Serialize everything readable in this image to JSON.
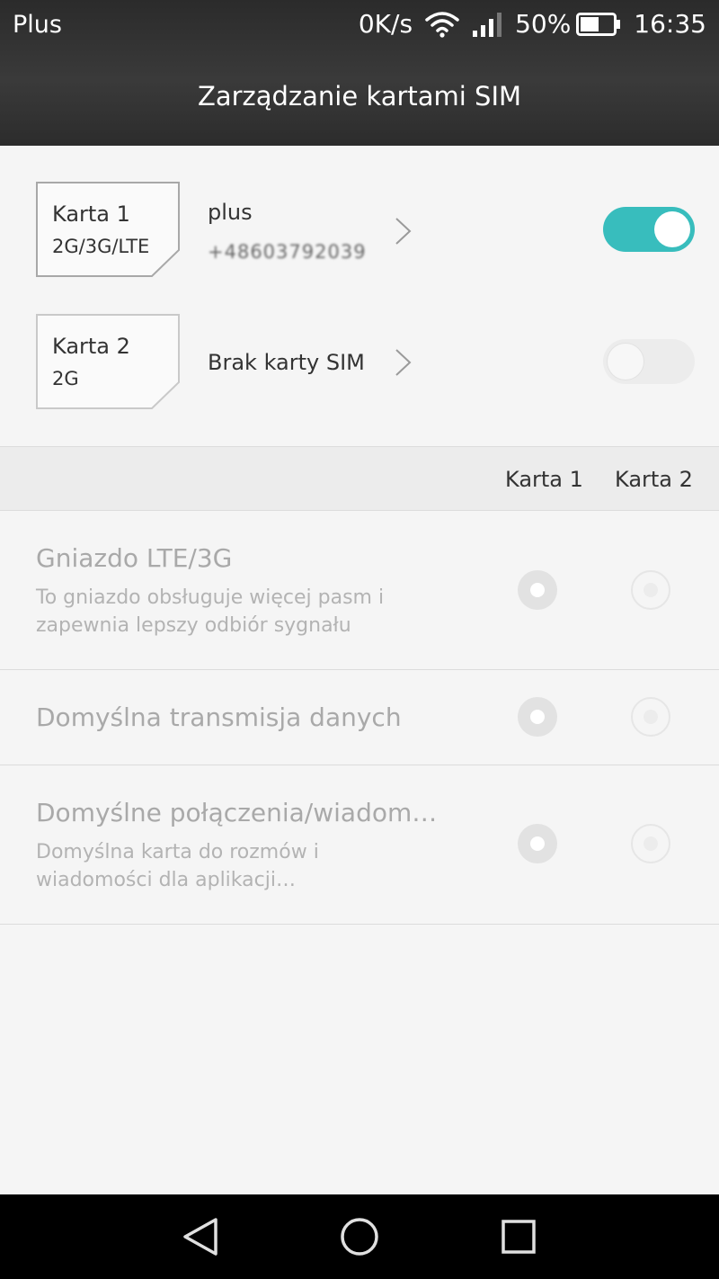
{
  "status_bar": {
    "carrier": "Plus",
    "speed": "0K/s",
    "battery": "50%",
    "time": "16:35",
    "icons": [
      "wifi-icon",
      "signal-icon",
      "battery-icon"
    ]
  },
  "header": {
    "title": "Zarządzanie kartami SIM"
  },
  "sims": [
    {
      "name": "Karta 1",
      "network": "2G/3G/LTE",
      "operator": "plus",
      "number": "+48603792039",
      "enabled": true
    },
    {
      "name": "Karta 2",
      "network": "2G",
      "operator": "Brak karty SIM",
      "enabled": false
    }
  ],
  "columns": {
    "card1": "Karta 1",
    "card2": "Karta 2"
  },
  "settings": [
    {
      "title": "Gniazdo LTE/3G",
      "desc_line1": "To gniazdo obsługuje więcej pasm i",
      "desc_line2": "zapewnia lepszy odbiór sygnału",
      "selected": "card1"
    },
    {
      "title": "Domyślna transmisja danych",
      "selected": "card1"
    },
    {
      "title": "Domyślne połączenia/wiadom…",
      "desc_line1": "Domyślna karta do rozmów i",
      "desc_line2": "wiadomości dla aplikacji…",
      "selected": "card1"
    }
  ],
  "colors": {
    "accent": "#38bdbd",
    "header_bg": "#333333",
    "nav_bg": "#000000"
  },
  "nav": [
    "back-icon",
    "home-icon",
    "recents-icon"
  ]
}
